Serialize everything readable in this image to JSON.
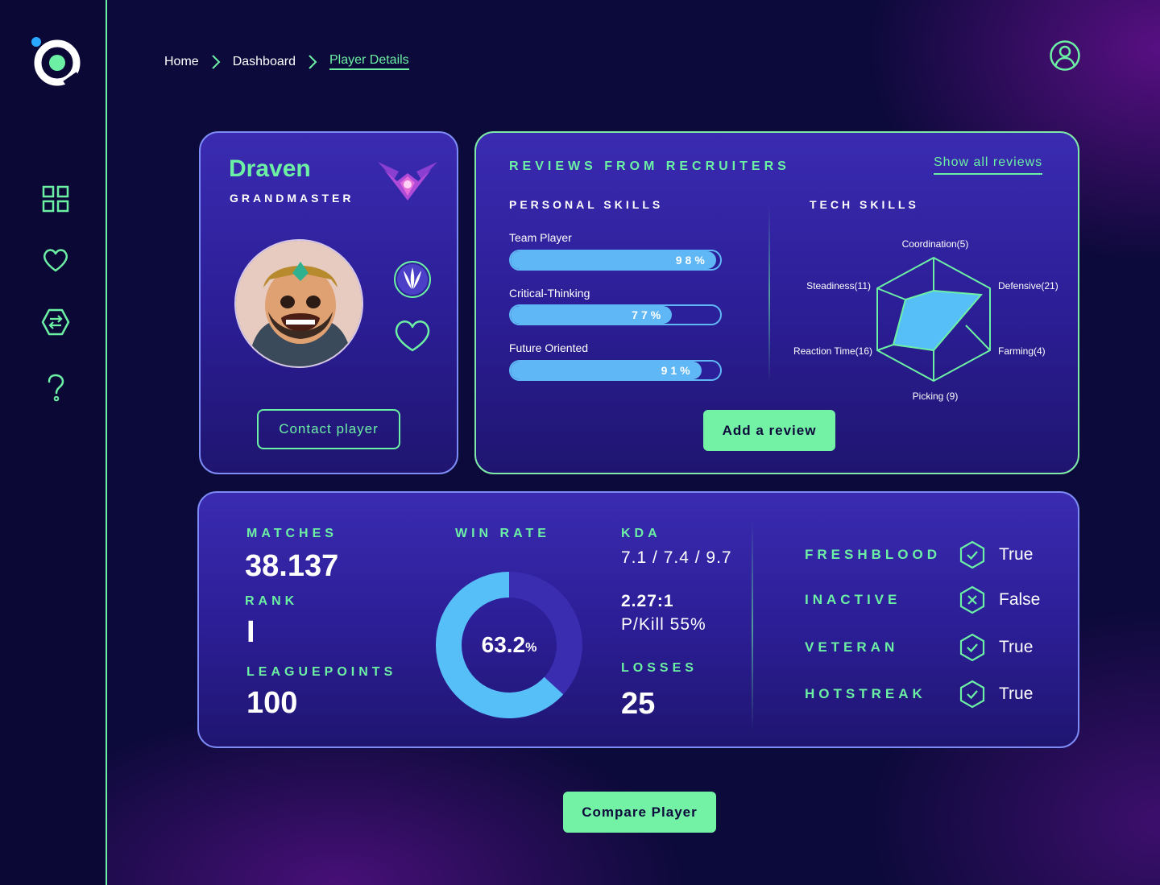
{
  "breadcrumb": {
    "home": "Home",
    "dashboard": "Dashboard",
    "current": "Player Details"
  },
  "sidebar": {
    "items": [
      {
        "icon": "dashboard-grid-icon"
      },
      {
        "icon": "heart-icon"
      },
      {
        "icon": "transfer-icon"
      },
      {
        "icon": "help-icon"
      }
    ]
  },
  "player": {
    "name": "Draven",
    "tier": "GRANDMASTER",
    "contact_label": "Contact player"
  },
  "reviews": {
    "title": "REVIEWS FROM RECRUITERS",
    "show_all": "Show all reviews",
    "personal_title": "PERSONAL SKILLS",
    "tech_title": "TECH SKILLS",
    "personal_skills": [
      {
        "label": "Team Player",
        "value": 98,
        "display": "98%"
      },
      {
        "label": "Critical-Thinking",
        "value": 77,
        "display": "77%"
      },
      {
        "label": "Future Oriented",
        "value": 91,
        "display": "91%"
      }
    ],
    "tech_skills": {
      "coordination": "Coordination(5)",
      "defensive": "Defensive(21)",
      "farming": "Farming(4)",
      "picking": "Picking (9)",
      "reaction": "Reaction Time(16)",
      "steadiness": "Steadiness(11)"
    },
    "add_review_label": "Add a review"
  },
  "stats": {
    "matches_label": "MATCHES",
    "matches_value": "38.137",
    "rank_label": "RANK",
    "rank_value": "I",
    "lp_label": "LEAGUEPOINTS",
    "lp_value": "100",
    "winrate_label": "WIN RATE",
    "winrate_value": "63.2",
    "winrate_unit": "%",
    "winrate_fraction": 0.632,
    "kda_label": "KDA",
    "kda_value": "7.1 / 7.4 / 9.7",
    "ratio_value": "2.27:1",
    "pkill_value": "P/Kill 55%",
    "losses_label": "LOSSES",
    "losses_value": "25"
  },
  "flags": [
    {
      "label": "FRESHBLOOD",
      "value": "True",
      "icon": "check-hex-icon"
    },
    {
      "label": "INACTIVE",
      "value": "False",
      "icon": "x-hex-icon"
    },
    {
      "label": "VETERAN",
      "value": "True",
      "icon": "check-hex-icon"
    },
    {
      "label": "HOTSTREAK",
      "value": "True",
      "icon": "check-hex-icon"
    }
  ],
  "compare_label": "Compare Player",
  "colors": {
    "accent": "#6cf0a4",
    "bar": "#5fb7f5",
    "background": "#0c0a3a",
    "card": "#2f22a2"
  }
}
